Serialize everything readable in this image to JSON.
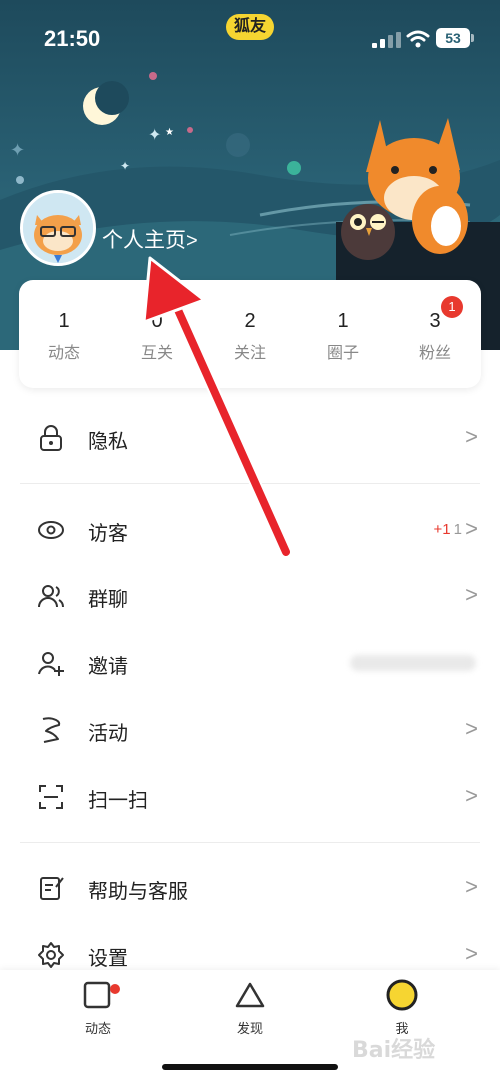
{
  "status_bar": {
    "time": "21:50",
    "app_badge": "狐友",
    "battery": "53"
  },
  "profile": {
    "link_label": "个人主页",
    "chevron": ">"
  },
  "stats": [
    {
      "value": "1",
      "label": "动态"
    },
    {
      "value": "0",
      "label": "互关"
    },
    {
      "value": "2",
      "label": "关注"
    },
    {
      "value": "1",
      "label": "圈子"
    },
    {
      "value": "3",
      "label": "粉丝",
      "badge": "1"
    }
  ],
  "menu": {
    "chevron": ">",
    "privacy": {
      "label": "隐私",
      "icon": "lock-icon"
    },
    "visitors": {
      "label": "访客",
      "icon": "eye-icon",
      "new_count": "+1",
      "total_count": "1"
    },
    "group_chat": {
      "label": "群聊",
      "icon": "group-icon"
    },
    "invite": {
      "label": "邀请",
      "icon": "add-user-icon"
    },
    "activity": {
      "label": "活动",
      "icon": "flag-icon"
    },
    "scan": {
      "label": "扫一扫",
      "icon": "scan-icon"
    },
    "help": {
      "label": "帮助与客服",
      "icon": "help-icon"
    },
    "settings": {
      "label": "设置",
      "icon": "gear-icon"
    }
  },
  "tabbar": {
    "tabs": [
      {
        "label": "动态",
        "icon": "feed-square-icon",
        "has_dot": true
      },
      {
        "label": "发现",
        "icon": "discover-triangle-icon"
      },
      {
        "label": "我",
        "icon": "me-circle-icon",
        "active": true
      }
    ]
  },
  "colors": {
    "accent_yellow": "#f6d531",
    "badge_red": "#e8392e",
    "header_bg": "#2a6275",
    "annotation_arrow": "#e8242b"
  },
  "watermark": "Bai经验"
}
